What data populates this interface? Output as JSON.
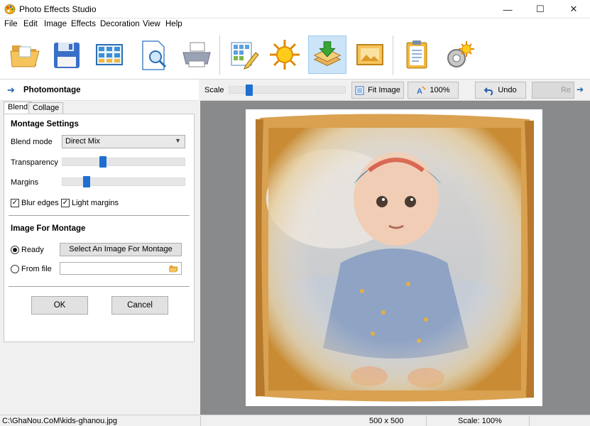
{
  "window": {
    "title": "Photo Effects Studio",
    "minimize": "—",
    "maximize": "☐",
    "close": "✕"
  },
  "menu": [
    "File",
    "Edit",
    "Image",
    "Effects",
    "Decoration",
    "View",
    "Help"
  ],
  "left_panel": {
    "title": "Photomontage",
    "tabs": [
      "Blend",
      "Collage"
    ],
    "montage_settings": {
      "heading": "Montage Settings",
      "blend_mode_label": "Blend mode",
      "blend_mode_value": "Direct Mix",
      "transparency_label": "Transparency",
      "transparency_level": 0.32,
      "margins_label": "Margins",
      "margins_level": 0.18,
      "blur_edges_label": "Blur edges",
      "blur_edges_checked": true,
      "light_margins_label": "Light margins",
      "light_margins_checked": true
    },
    "image_for_montage": {
      "heading": "Image For Montage",
      "ready_label": "Ready",
      "select_button": "Select An Image For Montage",
      "from_file_label": "From file",
      "from_file_value": ""
    },
    "ok": "OK",
    "cancel": "Cancel"
  },
  "view_toolbar": {
    "scale_label": "Scale",
    "scale_level": 0.15,
    "fit_image": "Fit Image",
    "zoom_100": "100%",
    "undo": "Undo",
    "redo": "Re"
  },
  "status": {
    "file_path": "C:\\GhaNou.CoM\\kids-ghanou.jpg",
    "dimensions": "500 x 500",
    "scale": "Scale: 100%"
  },
  "colors": {
    "accent": "#1e6fd0",
    "canvas": "#888a8c"
  },
  "toolbar_icons": [
    "open-folder-icon",
    "save-disk-icon",
    "gallery-icon",
    "preview-icon",
    "print-icon",
    "edit-grid-icon",
    "sun-effects-icon",
    "layers-import-icon",
    "picture-frame-icon",
    "clipboard-icon",
    "settings-gear-icon"
  ]
}
